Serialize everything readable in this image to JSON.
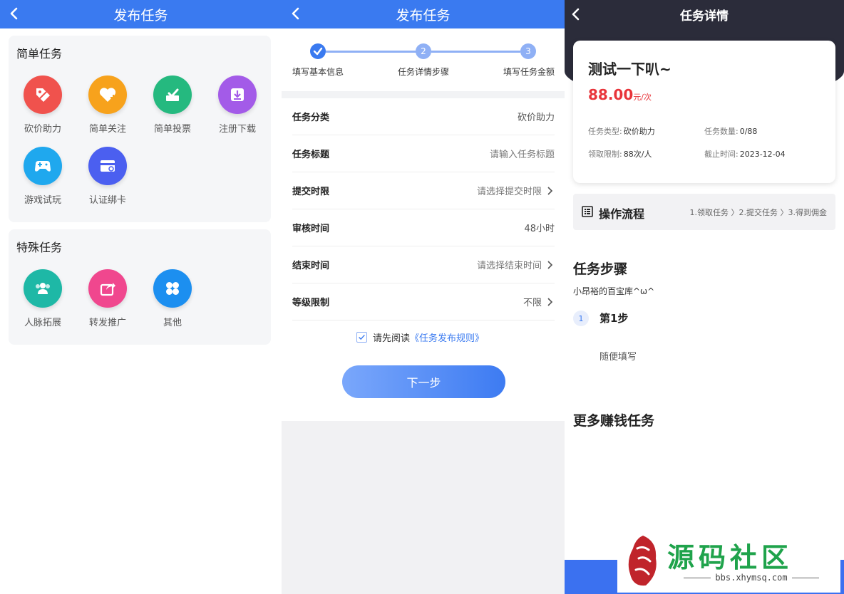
{
  "panel1": {
    "title": "发布任务",
    "simple": {
      "heading": "简单任务",
      "items": [
        {
          "label": "砍价助力",
          "icon": "price-tag-icon",
          "color": "#f0524d"
        },
        {
          "label": "简单关注",
          "icon": "heart-plus-icon",
          "color": "#f7a21c"
        },
        {
          "label": "简单投票",
          "icon": "vote-box-icon",
          "color": "#25b97f"
        },
        {
          "label": "注册下载",
          "icon": "download-icon",
          "color": "#a35be8"
        },
        {
          "label": "游戏试玩",
          "icon": "gamepad-icon",
          "color": "#1fa8ee"
        },
        {
          "label": "认证绑卡",
          "icon": "bank-card-icon",
          "color": "#4b5ff0"
        }
      ]
    },
    "special": {
      "heading": "特殊任务",
      "items": [
        {
          "label": "人脉拓展",
          "icon": "people-icon",
          "color": "#1eb8a6"
        },
        {
          "label": "转发推广",
          "icon": "share-icon",
          "color": "#f0478e"
        },
        {
          "label": "其他",
          "icon": "clover-icon",
          "color": "#1c8ff0"
        }
      ]
    }
  },
  "panel2": {
    "title": "发布任务",
    "steps": [
      {
        "label": "填写基本信息",
        "marker": "✓"
      },
      {
        "label": "任务详情步骤",
        "marker": "2"
      },
      {
        "label": "填写任务金额",
        "marker": "3"
      }
    ],
    "rows": [
      {
        "label": "任务分类",
        "value": "砍价助力"
      },
      {
        "label": "任务标题",
        "value": "请输入任务标题"
      },
      {
        "label": "提交时限",
        "value": "请选择提交时限"
      },
      {
        "label": "审核时间",
        "value": "48小时"
      },
      {
        "label": "结束时间",
        "value": "请选择结束时间"
      },
      {
        "label": "等级限制",
        "value": "不限"
      }
    ],
    "agree_prefix": "请先阅读",
    "agree_link": "《任务发布规则》",
    "next_button": "下一步"
  },
  "panel3": {
    "title": "任务详情",
    "task_title": "测试一下叭~",
    "price": "88.00",
    "price_unit": "元/次",
    "meta": {
      "type_label": "任务类型:",
      "type_value": "砍价助力",
      "count_label": "任务数量:",
      "count_value": "0/88",
      "limit_label": "领取限制:",
      "limit_value": "88次/人",
      "deadline_label": "截止时间:",
      "deadline_value": "2023-12-04"
    },
    "flow_title": "操作流程",
    "flow_steps": "1.领取任务 〉2.提交任务 〉3.得到佣金",
    "steps_heading": "任务步骤",
    "shop_name": "小昂裕的百宝库^ω^",
    "step_number": "1",
    "step_title": "第1步",
    "step_desc": "随便填写",
    "more_heading": "更多赚钱任务"
  },
  "watermark": {
    "site_name": "源码社区",
    "url": "bbs.xhymsq.com",
    "seal_color": "#c0242b"
  },
  "colors": {
    "primary": "#3a7af0",
    "price_red": "#e8343a",
    "dark_header": "#2b2c3a"
  }
}
